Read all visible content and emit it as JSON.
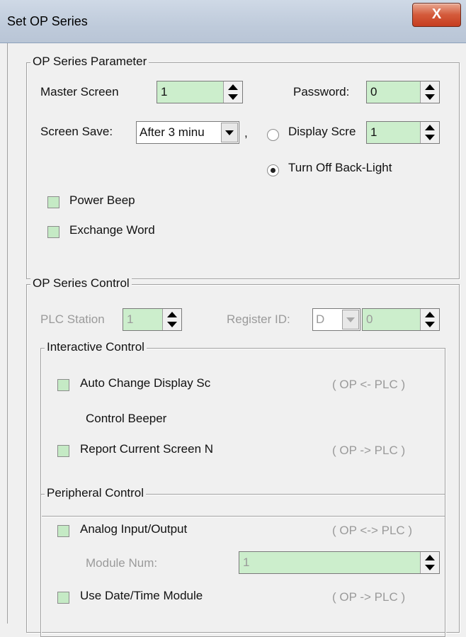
{
  "window": {
    "title": "Set OP Series",
    "close_glyph": "X"
  },
  "param_group": {
    "title": "OP Series Parameter",
    "master_screen_label": "Master Screen",
    "master_screen_value": "1",
    "password_label": "Password:",
    "password_value": "0",
    "screen_save_label": "Screen Save:",
    "screen_save_value": "After 3 minu",
    "comma": ",",
    "radio_display_label": "Display Scre",
    "display_screen_value": "1",
    "radio_backlight_label": "Turn Off Back-Light",
    "selected_radio": "Turn Off Back-Light",
    "power_beep_label": "Power Beep",
    "exchange_word_label": "Exchange Word"
  },
  "control_group": {
    "title": "OP Series Control",
    "plc_station_label": "PLC Station",
    "plc_station_value": "1",
    "register_id_label": "Register ID:",
    "register_type_value": "D",
    "register_value": "0",
    "interactive": {
      "title": "Interactive Control",
      "auto_change_label": "Auto Change Display Sc",
      "auto_change_dir": "( OP <- PLC )",
      "control_beeper_label": "Control Beeper",
      "report_screen_label": "Report Current Screen N",
      "report_screen_dir": "( OP -> PLC )"
    },
    "peripheral": {
      "title": "Peripheral Control",
      "analog_label": "Analog Input/Output",
      "analog_dir": "( OP <-> PLC )",
      "module_num_label": "Module Num:",
      "module_num_value": "1",
      "datetime_label": "Use Date/Time Module",
      "datetime_dir": "( OP -> PLC )"
    }
  },
  "colors": {
    "field_green": "#cceecc",
    "checkbox_green": "#c5eac5",
    "close_red": "#c63d20"
  }
}
